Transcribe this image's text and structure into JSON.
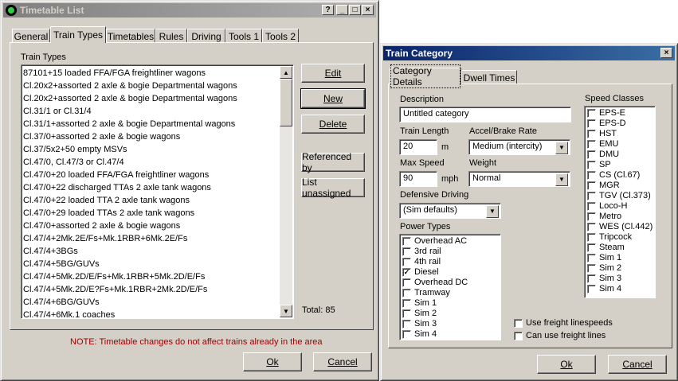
{
  "timetable_window": {
    "title": "Timetable List",
    "tabs": [
      "General",
      "Train Types",
      "Timetables",
      "Rules",
      "Driving",
      "Tools 1",
      "Tools 2"
    ],
    "selected_tab": "Train Types",
    "list_label": "Train Types",
    "train_types": [
      "87101+15 loaded FFA/FGA freightliner wagons",
      "Cl.20x2+assorted 2 axle & bogie Departmental wagons",
      "Cl.20x2+assorted 2 axle & bogie Departmental wagons",
      "Cl.31/1 or Cl.31/4",
      "Cl.31/1+assorted 2 axle & bogie Departmental wagons",
      "Cl.37/0+assorted 2 axle & bogie wagons",
      "Cl.37/5x2+50 empty MSVs",
      "Cl.47/0, Cl.47/3 or Cl.47/4",
      "Cl.47/0+20 loaded FFA/FGA freightliner wagons",
      "Cl.47/0+22 discharged TTAs 2 axle tank wagons",
      "Cl.47/0+22 loaded TTA 2 axle tank wagons",
      "Cl.47/0+29 loaded TTAs 2 axle tank wagons",
      "Cl.47/0+assorted 2 axle & bogie wagons",
      "Cl.47/4+2Mk.2E/Fs+Mk.1RBR+6Mk.2E/Fs",
      "Cl.47/4+3BGs",
      "Cl.47/4+5BG/GUVs",
      "Cl.47/4+5Mk.2D/E/Fs+Mk.1RBR+5Mk.2D/E/Fs",
      "Cl.47/4+5Mk.2D/E?Fs+Mk.1RBR+2Mk.2D/E/Fs",
      "Cl.47/4+6BG/GUVs",
      "Cl.47/4+6Mk.1 coaches"
    ],
    "buttons": {
      "edit": "Edit",
      "new": "New",
      "delete": "Delete",
      "referenced_by": "Referenced by",
      "list_unassigned": "List unassigned"
    },
    "total": "Total: 85",
    "note": "NOTE: Timetable changes do not affect trains already in the area",
    "ok": "Ok",
    "cancel": "Cancel",
    "help_btn": "?",
    "min_btn": "_",
    "max_btn": "□",
    "close_btn": "×"
  },
  "category_window": {
    "title": "Train Category",
    "close_btn": "×",
    "tabs": [
      "Category Details",
      "Dwell Times"
    ],
    "selected_tab": "Category Details",
    "description_label": "Description",
    "description_value": "Untitled category",
    "train_length_label": "Train Length",
    "train_length_value": "20",
    "train_length_unit": "m",
    "accel_label": "Accel/Brake Rate",
    "accel_value": "Medium (intercity)",
    "max_speed_label": "Max Speed",
    "max_speed_value": "90",
    "max_speed_unit": "mph",
    "weight_label": "Weight",
    "weight_value": "Normal",
    "defensive_label": "Defensive Driving",
    "defensive_value": "(Sim defaults)",
    "power_types_label": "Power Types",
    "power_types": [
      {
        "label": "Overhead AC",
        "checked": false
      },
      {
        "label": "3rd rail",
        "checked": false
      },
      {
        "label": "4th rail",
        "checked": false
      },
      {
        "label": "Diesel",
        "checked": true
      },
      {
        "label": "Overhead DC",
        "checked": false
      },
      {
        "label": "Tramway",
        "checked": false
      },
      {
        "label": "Sim 1",
        "checked": false
      },
      {
        "label": "Sim 2",
        "checked": false
      },
      {
        "label": "Sim 3",
        "checked": false
      },
      {
        "label": "Sim 4",
        "checked": false
      }
    ],
    "speed_classes_label": "Speed Classes",
    "speed_classes": [
      "EPS-E",
      "EPS-D",
      "HST",
      "EMU",
      "DMU",
      "SP",
      "CS (Cl.67)",
      "MGR",
      "TGV (Cl.373)",
      "Loco-H",
      "Metro",
      "WES (Cl.442)",
      "Tripcock",
      "Steam",
      "Sim 1",
      "Sim 2",
      "Sim 3",
      "Sim 4"
    ],
    "use_freight_linespeeds": "Use freight linespeeds",
    "can_use_freight_lines": "Can use freight lines",
    "ok": "Ok",
    "cancel": "Cancel"
  }
}
